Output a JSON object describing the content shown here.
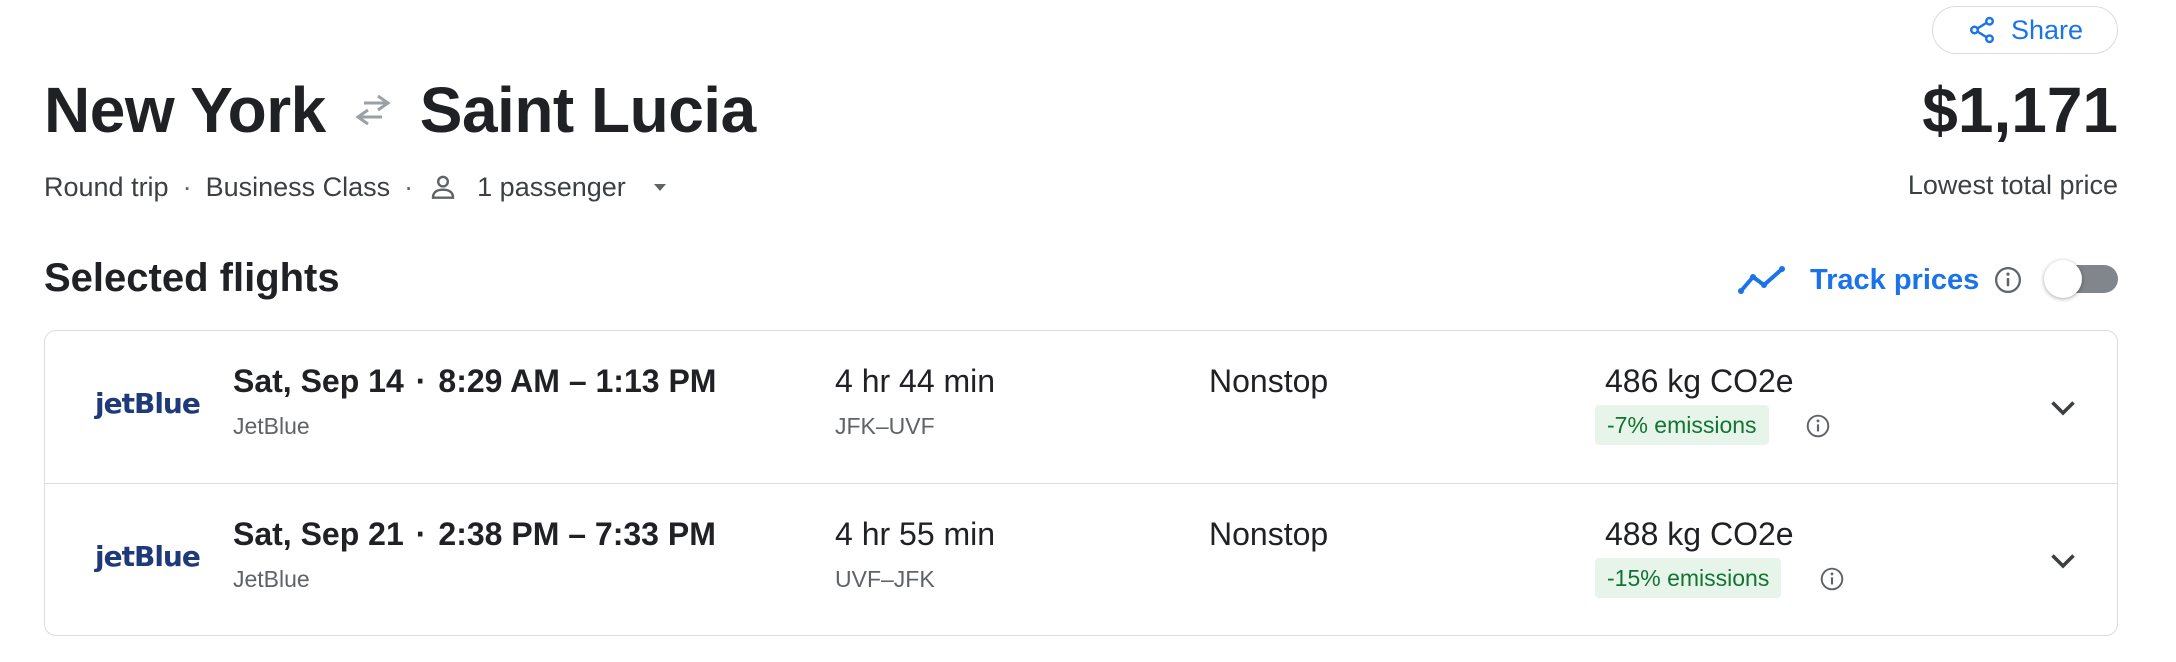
{
  "share": {
    "label": "Share"
  },
  "route": {
    "origin": "New York",
    "destination": "Saint Lucia"
  },
  "trip": {
    "type": "Round trip",
    "cabin": "Business Class",
    "passengers": "1 passenger"
  },
  "price": {
    "amount": "$1,171",
    "label": "Lowest total price"
  },
  "section": {
    "title": "Selected flights"
  },
  "track": {
    "label": "Track prices",
    "enabled": false
  },
  "flights": [
    {
      "logo": "jetBlue",
      "date": "Sat, Sep 14",
      "times": "8:29 AM – 1:13 PM",
      "airline": "JetBlue",
      "duration": "4 hr 44 min",
      "airports": "JFK–UVF",
      "stops": "Nonstop",
      "co2": "486 kg CO2e",
      "emissions": "-7% emissions"
    },
    {
      "logo": "jetBlue",
      "date": "Sat, Sep 21",
      "times": "2:38 PM – 7:33 PM",
      "airline": "JetBlue",
      "duration": "4 hr 55 min",
      "airports": "UVF–JFK",
      "stops": "Nonstop",
      "co2": "488 kg CO2e",
      "emissions": "-15% emissions"
    }
  ],
  "colors": {
    "accent": "#1a73e8",
    "emissions_bg": "#e6f4ea",
    "emissions_text": "#137333"
  }
}
